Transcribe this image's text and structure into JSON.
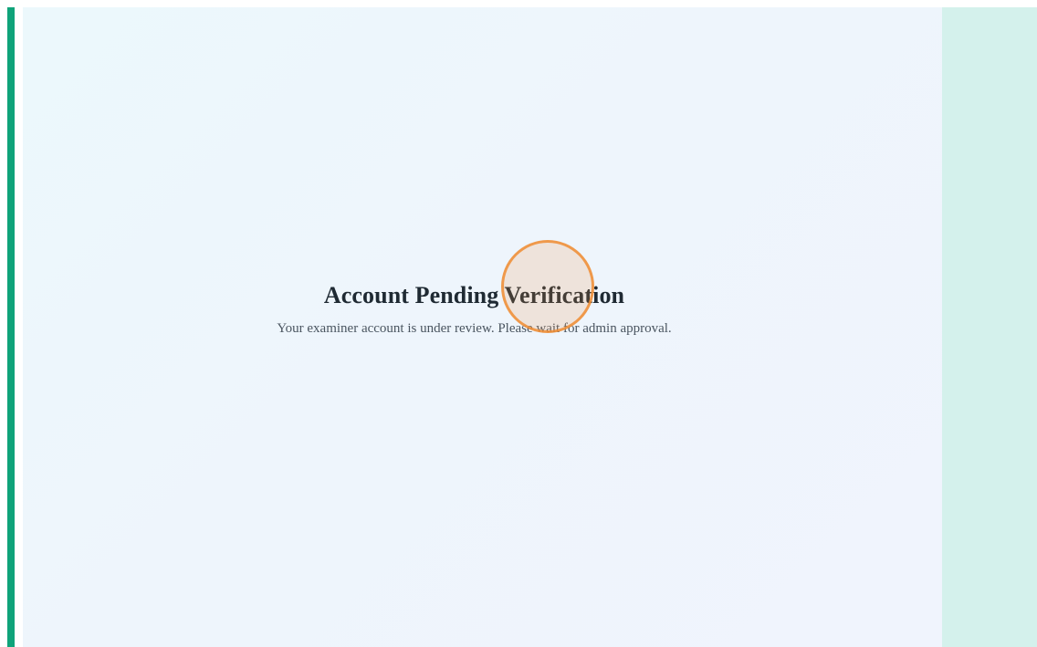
{
  "message": {
    "title": "Account Pending Verification",
    "subtitle": "Your examiner account is under review. Please wait for admin approval."
  },
  "colors": {
    "accent": "#0fa37a",
    "right_panel": "#d4f1ec",
    "click_marker": "#f08c32"
  }
}
